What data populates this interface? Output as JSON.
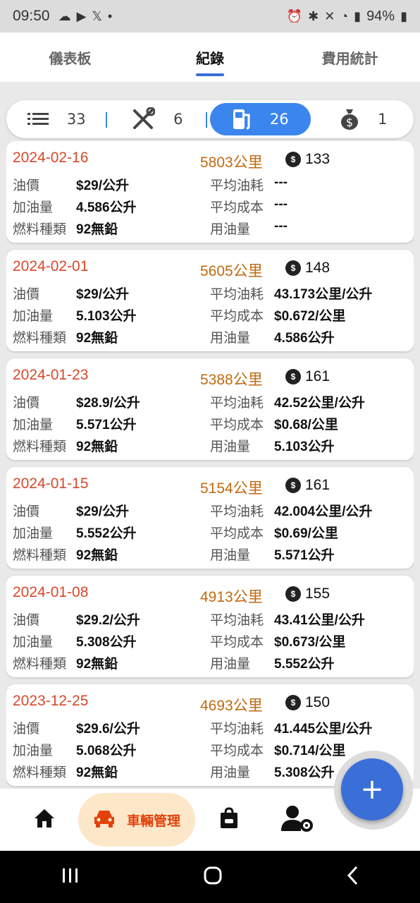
{
  "status_bar": {
    "time": "09:50",
    "battery": "94%",
    "icons_left": [
      "cloud-icon",
      "youtube-icon",
      "x-icon",
      "dot-icon"
    ],
    "icons_right": [
      "alarm-icon",
      "bluetooth-icon",
      "mute-icon",
      "wifi-icon",
      "volte-icon",
      "signal-icon",
      "battery-icon"
    ]
  },
  "top_tabs": [
    {
      "label": "儀表板",
      "active": false
    },
    {
      "label": "紀錄",
      "active": true
    },
    {
      "label": "費用統計",
      "active": false
    }
  ],
  "filters": [
    {
      "icon": "list-icon",
      "count": "33",
      "active": false
    },
    {
      "icon": "tools-icon",
      "count": "6",
      "active": false
    },
    {
      "icon": "fuel-pump-icon",
      "count": "26",
      "active": true
    },
    {
      "icon": "money-bag-icon",
      "count": "1",
      "active": false
    }
  ],
  "labels": {
    "price": "油價",
    "amount": "加油量",
    "fuel_type": "燃料種類",
    "avg_consumption": "平均油耗",
    "avg_cost": "平均成本",
    "fuel_used": "用油量"
  },
  "records": [
    {
      "date": "2024-02-16",
      "odometer": "5803公里",
      "cost": "133",
      "price": "$29/公升",
      "amount": "4.586公升",
      "fuel_type": "92無鉛",
      "avg_consumption": "---",
      "avg_cost": "---",
      "fuel_used": "---"
    },
    {
      "date": "2024-02-01",
      "odometer": "5605公里",
      "cost": "148",
      "price": "$29/公升",
      "amount": "5.103公升",
      "fuel_type": "92無鉛",
      "avg_consumption": "43.173公里/公升",
      "avg_cost": "$0.672/公里",
      "fuel_used": "4.586公升"
    },
    {
      "date": "2024-01-23",
      "odometer": "5388公里",
      "cost": "161",
      "price": "$28.9/公升",
      "amount": "5.571公升",
      "fuel_type": "92無鉛",
      "avg_consumption": "42.52公里/公升",
      "avg_cost": "$0.68/公里",
      "fuel_used": "5.103公升"
    },
    {
      "date": "2024-01-15",
      "odometer": "5154公里",
      "cost": "161",
      "price": "$29/公升",
      "amount": "5.552公升",
      "fuel_type": "92無鉛",
      "avg_consumption": "42.004公里/公升",
      "avg_cost": "$0.69/公里",
      "fuel_used": "5.571公升"
    },
    {
      "date": "2024-01-08",
      "odometer": "4913公里",
      "cost": "155",
      "price": "$29.2/公升",
      "amount": "5.308公升",
      "fuel_type": "92無鉛",
      "avg_consumption": "43.41公里/公升",
      "avg_cost": "$0.673/公里",
      "fuel_used": "5.552公升"
    },
    {
      "date": "2023-12-25",
      "odometer": "4693公里",
      "cost": "150",
      "price": "$29.6/公升",
      "amount": "5.068公升",
      "fuel_type": "92無鉛",
      "avg_consumption": "41.445公里/公升",
      "avg_cost": "$0.714/公里",
      "fuel_used": "5.308公升"
    }
  ],
  "bottom_nav": {
    "items": [
      {
        "icon": "home-icon"
      },
      {
        "icon": "car-icon",
        "label": "車輛管理",
        "active": true
      },
      {
        "icon": "shopping-bag-icon"
      },
      {
        "icon": "user-settings-icon"
      }
    ]
  },
  "fab": {
    "label": "+"
  },
  "colors": {
    "accent": "#3b6fd8",
    "date": "#d9482b",
    "odometer": "#c06a10",
    "active_nav_bg": "#fde7c9"
  }
}
